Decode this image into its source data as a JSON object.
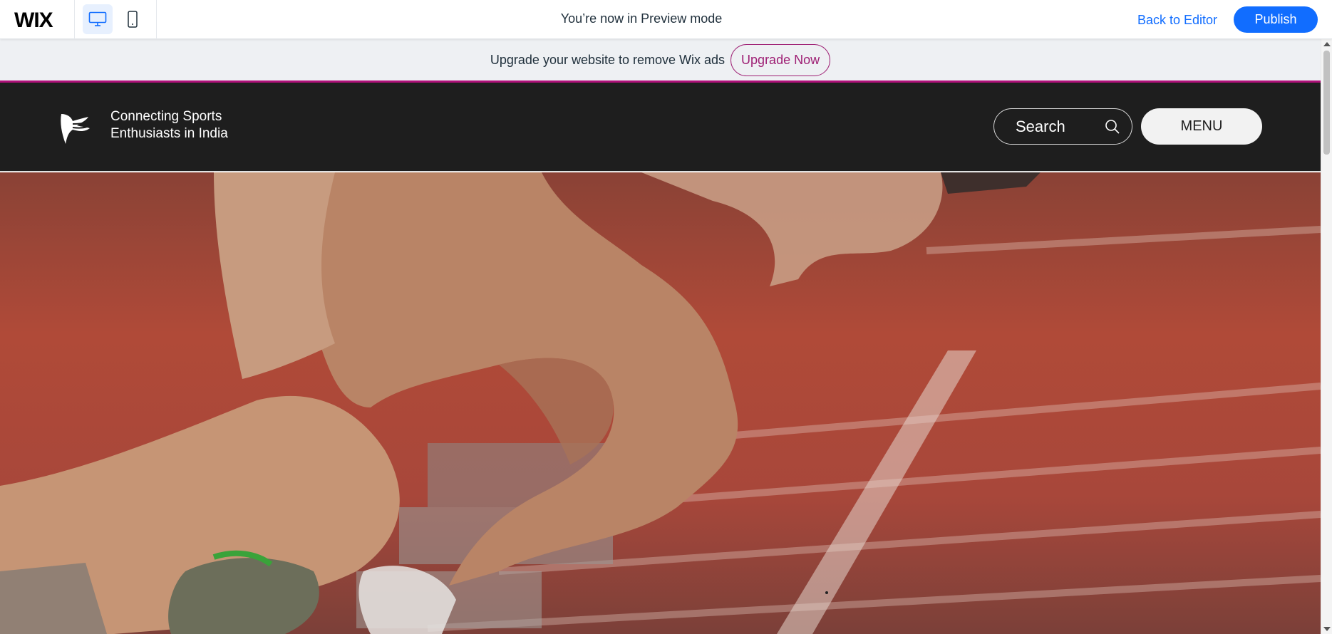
{
  "topbar": {
    "logo_text": "WIX",
    "devices": [
      {
        "name": "desktop",
        "icon": "desktop-icon",
        "active": true
      },
      {
        "name": "mobile",
        "icon": "mobile-icon",
        "active": false
      }
    ],
    "preview_message": "You’re now in Preview mode",
    "back_to_editor": "Back to Editor",
    "publish": "Publish",
    "accent_color": "#116dff"
  },
  "upgrade_banner": {
    "text": "Upgrade your website to remove Wix ads",
    "button": "Upgrade Now",
    "accent_color": "#9e1f74"
  },
  "site_header": {
    "logo_icon": "bird-logo-icon",
    "tagline_line1": "Connecting Sports",
    "tagline_line2": "Enthusiasts in India",
    "search_placeholder": "Search",
    "menu_label": "MENU",
    "background": "#1e1e1e"
  },
  "hero": {
    "image": "sprinters-starting-blocks-photo"
  }
}
